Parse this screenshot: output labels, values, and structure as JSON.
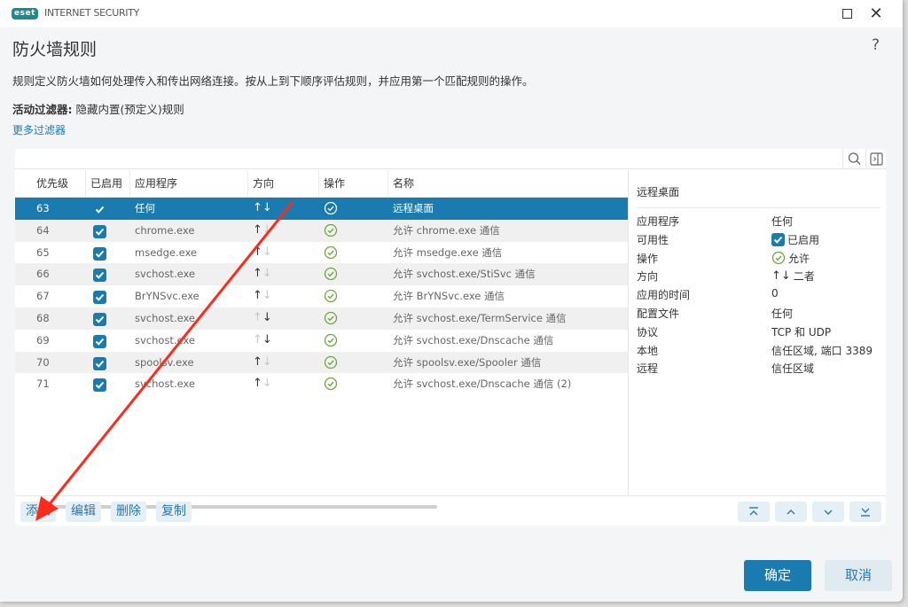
{
  "window": {
    "logo_text": "eset",
    "app_name": "INTERNET SECURITY",
    "maximize_icon": "maximize-icon",
    "close_icon": "close-icon",
    "close_glyph": "✕"
  },
  "page": {
    "title": "防火墙规则",
    "help_glyph": "?",
    "description": "规则定义防火墙如何处理传入和传出网络连接。按从上到下顺序评估规则，并应用第一个匹配规则的操作。",
    "filter_label": "活动过滤器:",
    "filter_value": " 隐藏内置(预定义)规则",
    "more_filters": "更多过滤器"
  },
  "toolbar": {
    "search_icon": "search-icon",
    "panel_toggle_icon": "panel-toggle-icon"
  },
  "table": {
    "columns": [
      "优先级",
      "已启用",
      "应用程序",
      "方向",
      "操作",
      "名称"
    ],
    "rows": [
      {
        "priority": "63",
        "enabled": true,
        "app": "任何",
        "direction": "both",
        "action": "allow",
        "name": "远程桌面",
        "selected": true
      },
      {
        "priority": "64",
        "enabled": true,
        "app": "chrome.exe",
        "direction": "out",
        "action": "allow",
        "name": "允许 chrome.exe 通信"
      },
      {
        "priority": "65",
        "enabled": true,
        "app": "msedge.exe",
        "direction": "out",
        "action": "allow",
        "name": "允许 msedge.exe 通信"
      },
      {
        "priority": "66",
        "enabled": true,
        "app": "svchost.exe",
        "direction": "out",
        "action": "allow",
        "name": "允许 svchost.exe/StiSvc 通信"
      },
      {
        "priority": "67",
        "enabled": true,
        "app": "BrYNSvc.exe",
        "direction": "out",
        "action": "allow",
        "name": "允许 BrYNSvc.exe 通信"
      },
      {
        "priority": "68",
        "enabled": true,
        "app": "svchost.exe",
        "direction": "in",
        "action": "allow",
        "name": "允许 svchost.exe/TermService 通信"
      },
      {
        "priority": "69",
        "enabled": true,
        "app": "svchost.exe",
        "direction": "in",
        "action": "allow",
        "name": "允许 svchost.exe/Dnscache 通信"
      },
      {
        "priority": "70",
        "enabled": true,
        "app": "spoolsv.exe",
        "direction": "out",
        "action": "allow",
        "name": "允许 spoolsv.exe/Spooler 通信"
      },
      {
        "priority": "71",
        "enabled": true,
        "app": "svchost.exe",
        "direction": "out",
        "action": "allow",
        "name": "允许 svchost.exe/Dnscache 通信 (2)"
      }
    ]
  },
  "detail": {
    "title": "远程桌面",
    "fields": [
      {
        "label": "应用程序",
        "value": "任何"
      },
      {
        "label": "可用性",
        "value": "已启用",
        "icon": "checkbox"
      },
      {
        "label": "操作",
        "value": "允许",
        "icon": "check-circle"
      },
      {
        "label": "方向",
        "value": "二者",
        "icon": "arrows-both"
      },
      {
        "label": "应用的时间",
        "value": "0"
      },
      {
        "label": "配置文件",
        "value": "任何"
      },
      {
        "label": "协议",
        "value": "TCP 和 UDP"
      },
      {
        "label": "本地",
        "value": "信任区域, 端口 3389"
      },
      {
        "label": "远程",
        "value": "信任区域"
      }
    ]
  },
  "actions": {
    "add": "添加",
    "edit": "编辑",
    "delete": "删除",
    "copy": "复制",
    "move_top_icon": "move-top-icon",
    "move_up_icon": "move-up-icon",
    "move_down_icon": "move-down-icon",
    "move_bottom_icon": "move-bottom-icon"
  },
  "footer": {
    "ok": "确定",
    "cancel": "取消"
  },
  "colors": {
    "accent": "#1a7bb0",
    "allow_green": "#6aaa3a",
    "annotation_red": "#ff2a1a"
  }
}
